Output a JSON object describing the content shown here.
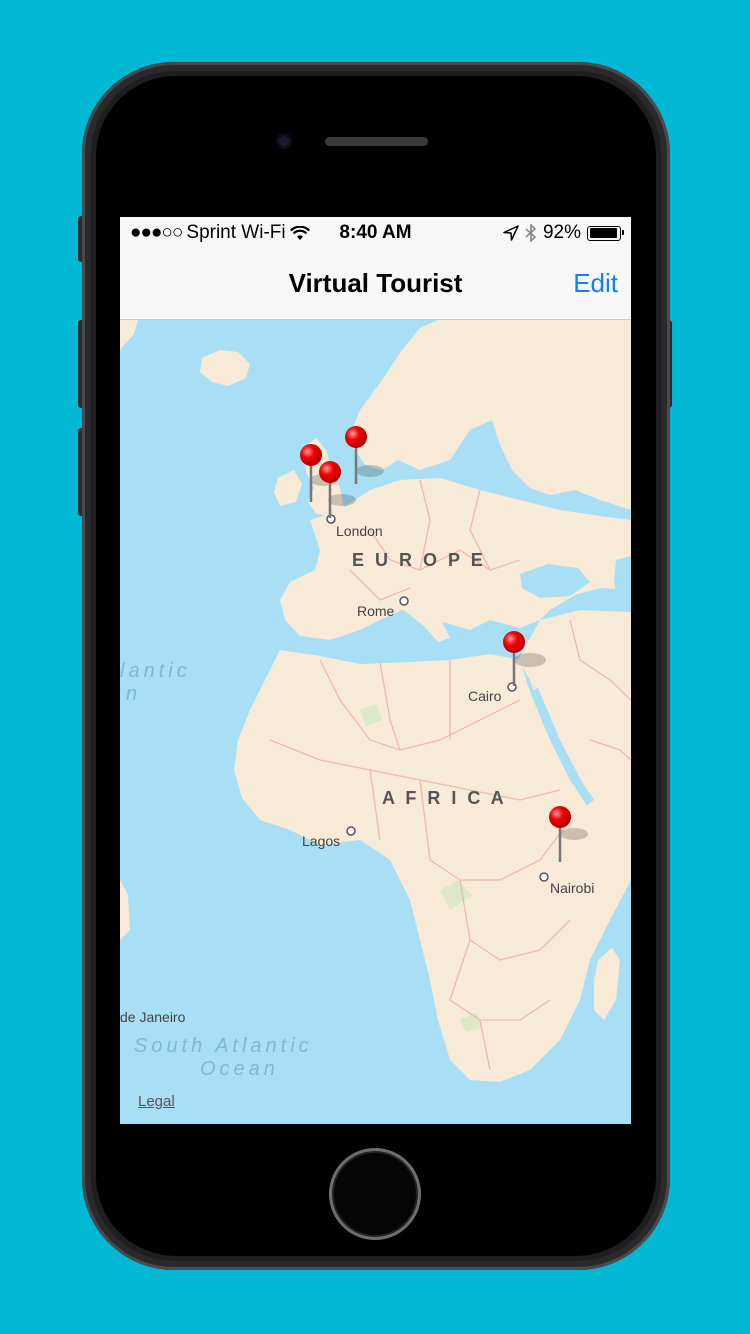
{
  "status_bar": {
    "signal_dots": "●●●○○",
    "carrier": "Sprint Wi-Fi",
    "wifi_icon": "wifi-icon",
    "time": "8:40 AM",
    "location_icon": "location-arrow-icon",
    "bluetooth_icon": "bluetooth-icon",
    "battery_percent": "92%",
    "battery_level": 0.92
  },
  "nav": {
    "title": "Virtual Tourist",
    "edit_label": "Edit"
  },
  "map": {
    "continent_labels": [
      "E U R O P E",
      "A F R I C A"
    ],
    "ocean_labels": [
      "South Atlantic",
      "Ocean",
      "lantic",
      "n"
    ],
    "city_labels": [
      "London",
      "Rome",
      "Cairo",
      "Lagos",
      "Nairobi",
      "de Janeiro"
    ],
    "legal_label": "Legal",
    "pin_count": 5,
    "colors": {
      "water": "#a8dff5",
      "land": "#f7ead6",
      "border": "#f0b8b0",
      "pin": "#e60000"
    }
  }
}
